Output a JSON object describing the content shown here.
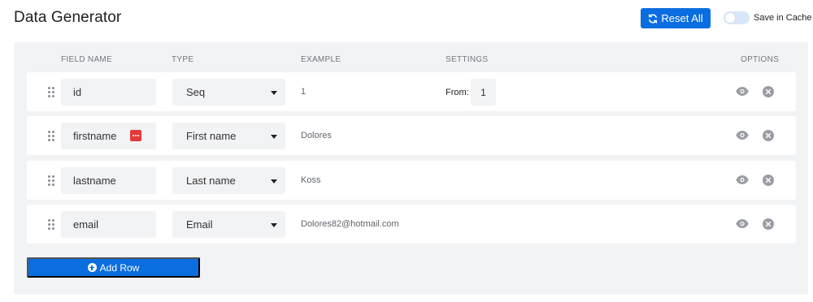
{
  "header": {
    "title": "Data Generator",
    "reset_label": "Reset All",
    "cache_label": "Save in Cache",
    "cache_enabled": false
  },
  "table": {
    "columns": {
      "field_name": "FIELD NAME",
      "type": "TYPE",
      "example": "EXAMPLE",
      "settings": "SETTINGS",
      "options": "OPTIONS"
    },
    "rows": [
      {
        "field": "id",
        "type": "Seq",
        "example": "1",
        "settings_label": "From:",
        "settings_value": "1"
      },
      {
        "field": "firstname",
        "type": "First name",
        "example": "Dolores"
      },
      {
        "field": "lastname",
        "type": "Last name",
        "example": "Koss"
      },
      {
        "field": "email",
        "type": "Email",
        "example": "Dolores82@hotmail.com"
      }
    ]
  },
  "footer": {
    "add_row_label": "Add Row"
  },
  "icons": {
    "reset": "refresh-icon",
    "drag": "drag-handle-icon",
    "more": "more-options-icon",
    "caret": "caret-down-icon",
    "visibility": "eye-icon",
    "remove": "close-circle-icon",
    "add": "plus-circle-icon"
  },
  "colors": {
    "primary": "#0b6ee0",
    "panel_bg": "#f2f3f5",
    "badge_red": "#e03a3a",
    "icon_gray": "#9a9ea4"
  }
}
